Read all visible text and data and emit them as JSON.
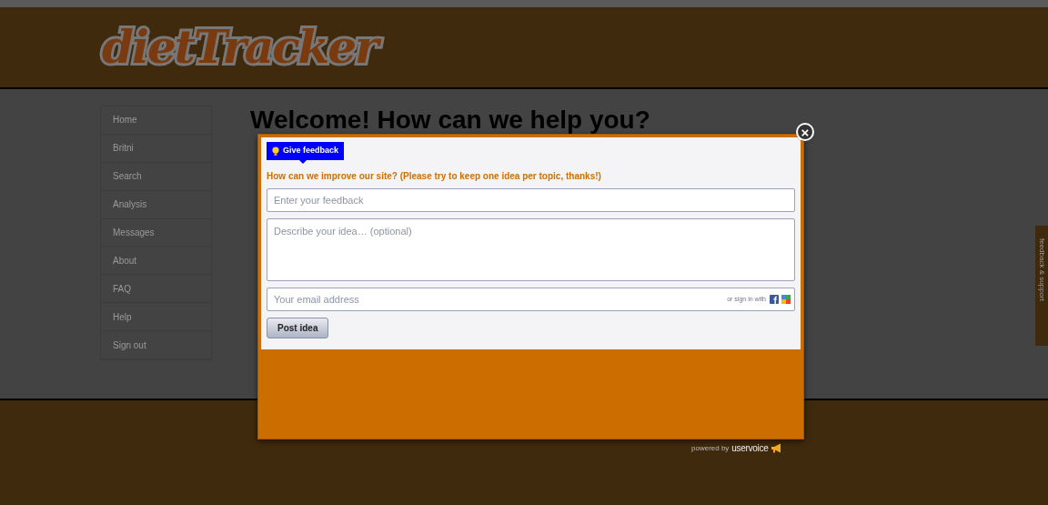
{
  "logo": "dietTracker",
  "nav": [
    {
      "label": "Home"
    },
    {
      "label": "Britni"
    },
    {
      "label": "Search"
    },
    {
      "label": "Analysis"
    },
    {
      "label": "Messages"
    },
    {
      "label": "About"
    },
    {
      "label": "FAQ"
    },
    {
      "label": "Help"
    },
    {
      "label": "Sign out"
    }
  ],
  "heading": "Welcome! How can we help you?",
  "side_tab": "feedback & support",
  "modal": {
    "badge": "Give feedback",
    "prompt": "How can we improve our site? (Please try to keep one idea per topic, thanks!)",
    "title_field": {
      "placeholder": "Enter your feedback"
    },
    "description_field": {
      "placeholder": "Describe your idea… (optional)"
    },
    "email_field": {
      "placeholder": "Your email address",
      "sign_in_hint": "or sign in with"
    },
    "submit": "Post idea",
    "close": "×",
    "powered_by": "powered by",
    "brand": "uservoice"
  }
}
